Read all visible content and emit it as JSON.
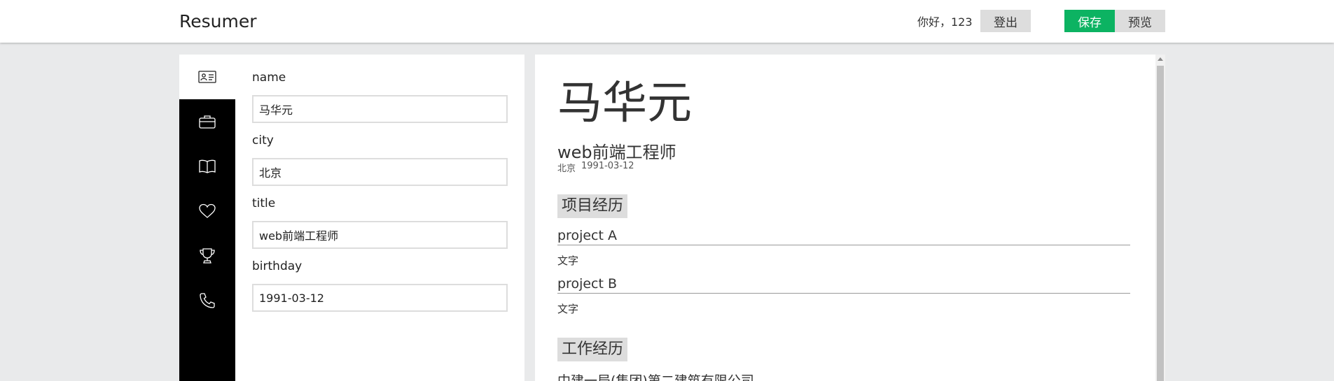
{
  "header": {
    "logo": "Resumer",
    "greeting": "你好，123",
    "logout_label": "登出",
    "save_label": "保存",
    "preview_label": "预览"
  },
  "sidebar": {
    "items": [
      {
        "icon": "id-card-icon",
        "active": true
      },
      {
        "icon": "briefcase-icon",
        "active": false
      },
      {
        "icon": "book-icon",
        "active": false
      },
      {
        "icon": "heart-icon",
        "active": false
      },
      {
        "icon": "trophy-icon",
        "active": false
      },
      {
        "icon": "phone-icon",
        "active": false
      }
    ]
  },
  "editor": {
    "fields": [
      {
        "label": "name",
        "value": "马华元"
      },
      {
        "label": "city",
        "value": "北京"
      },
      {
        "label": "title",
        "value": "web前端工程师"
      },
      {
        "label": "birthday",
        "value": "1991-03-12"
      }
    ]
  },
  "preview": {
    "name": "马华元",
    "title": "web前端工程师",
    "city": "北京",
    "birthday": "1991-03-12",
    "projects_heading": "项目经历",
    "projects": [
      {
        "name": "project A",
        "desc": "文字"
      },
      {
        "name": "project B",
        "desc": "文字"
      }
    ],
    "work_heading": "工作经历",
    "work": [
      {
        "company": "中建一局(集团)第二建筑有限公司"
      }
    ]
  },
  "colors": {
    "accent": "#0cb362",
    "sidebar": "#000000",
    "background": "#e9eaeb"
  }
}
